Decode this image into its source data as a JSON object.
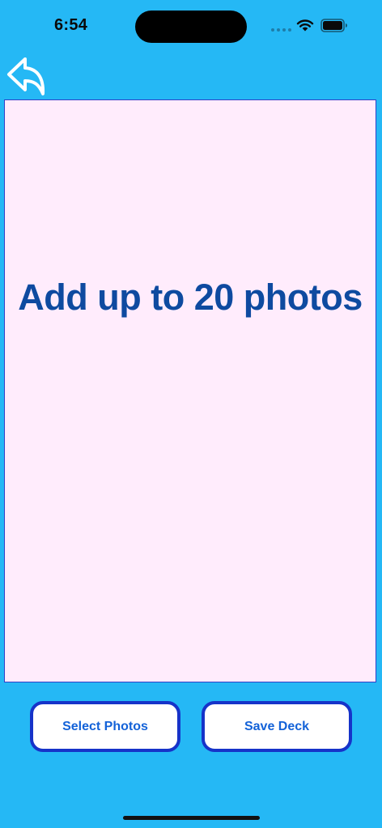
{
  "status_bar": {
    "time": "6:54"
  },
  "photo_area": {
    "prompt": "Add up to 20 photos"
  },
  "buttons": {
    "select_photos": "Select Photos",
    "save_deck": "Save Deck"
  },
  "icons": {
    "back": "back-arrow-icon",
    "wifi": "wifi-icon",
    "battery": "battery-icon",
    "cellular": "cellular-signal-icon"
  },
  "colors": {
    "background": "#25b8f5",
    "photo_area": "#ffecfc",
    "prompt_text": "#0e4aa0",
    "button_border": "#1633c9",
    "button_text": "#1362d8"
  }
}
